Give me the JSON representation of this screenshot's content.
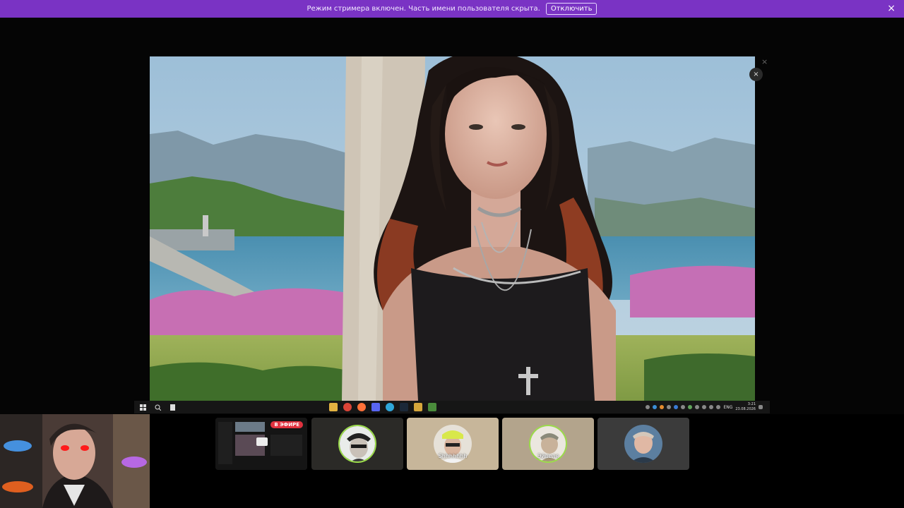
{
  "banner": {
    "message": "Режим стримера включен. Часть имени пользователя скрыта.",
    "disable_label": "Отключить",
    "close_icon": "×",
    "color": "#7a33c4"
  },
  "viewer": {
    "close_icon": "×"
  },
  "taskbar": {
    "language": "ENG",
    "time": "3:21",
    "date": "23.08.2026"
  },
  "participants": [
    {
      "id": "screen-share",
      "live_label": "В ЭФИРЕ"
    },
    {
      "id": "participant-1",
      "name": ""
    },
    {
      "id": "participant-2",
      "name": "Shhhhhhh"
    },
    {
      "id": "participant-3",
      "name": "Эйвеля"
    },
    {
      "id": "participant-4",
      "name": ""
    }
  ]
}
